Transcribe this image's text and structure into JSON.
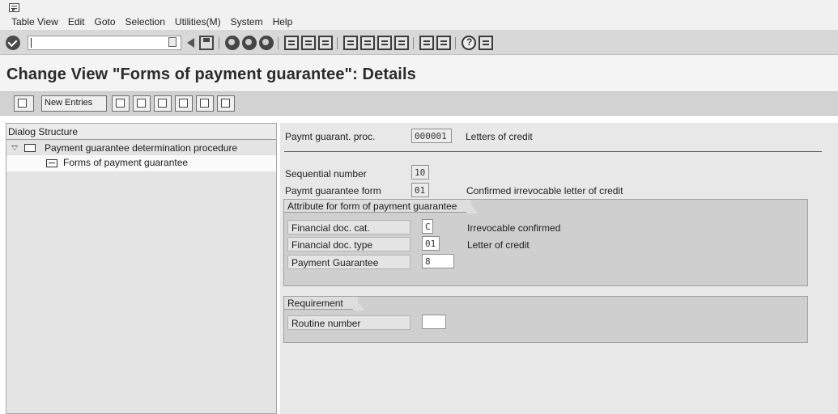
{
  "menu": {
    "items": [
      "Table View",
      "Edit",
      "Goto",
      "Selection",
      "Utilities(M)",
      "System",
      "Help"
    ]
  },
  "toolbar": {
    "command_value": "",
    "icons": [
      "enter-icon",
      "back-icon",
      "save-icon",
      "back-circle-icon",
      "exit-icon",
      "cancel-icon",
      "print-icon",
      "find-icon",
      "find-next-icon",
      "first-page-icon",
      "prev-page-icon",
      "next-page-icon",
      "last-page-icon",
      "new-session-icon",
      "shortcut-icon",
      "help-icon",
      "customize-layout-icon"
    ]
  },
  "title": "Change View \"Forms of payment guarantee\": Details",
  "app_toolbar": {
    "new_entries_label": "New Entries"
  },
  "dialog": {
    "header": "Dialog Structure",
    "root_label": "Payment guarantee determination procedure",
    "child_label": "Forms of payment guarantee"
  },
  "details": {
    "proc_label": "Paymt guarant. proc.",
    "proc_value": "000001",
    "proc_desc": "Letters of credit",
    "seq_label": "Sequential number",
    "seq_value": "10",
    "form_label": "Paymt guarantee form",
    "form_value": "01",
    "form_desc": "Confirmed irrevocable letter of credit",
    "attr_group_title": "Attribute for form of payment guarantee",
    "fin_cat_label": "Financial doc. cat.",
    "fin_cat_value": "C",
    "fin_cat_desc": "Irrevocable confirmed",
    "fin_type_label": "Financial doc. type",
    "fin_type_value": "01",
    "fin_type_desc": "Letter of credit",
    "pay_guar_label": "Payment Guarantee",
    "pay_guar_value": "8",
    "req_group_title": "Requirement",
    "routine_label": "Routine number",
    "routine_value": ""
  }
}
